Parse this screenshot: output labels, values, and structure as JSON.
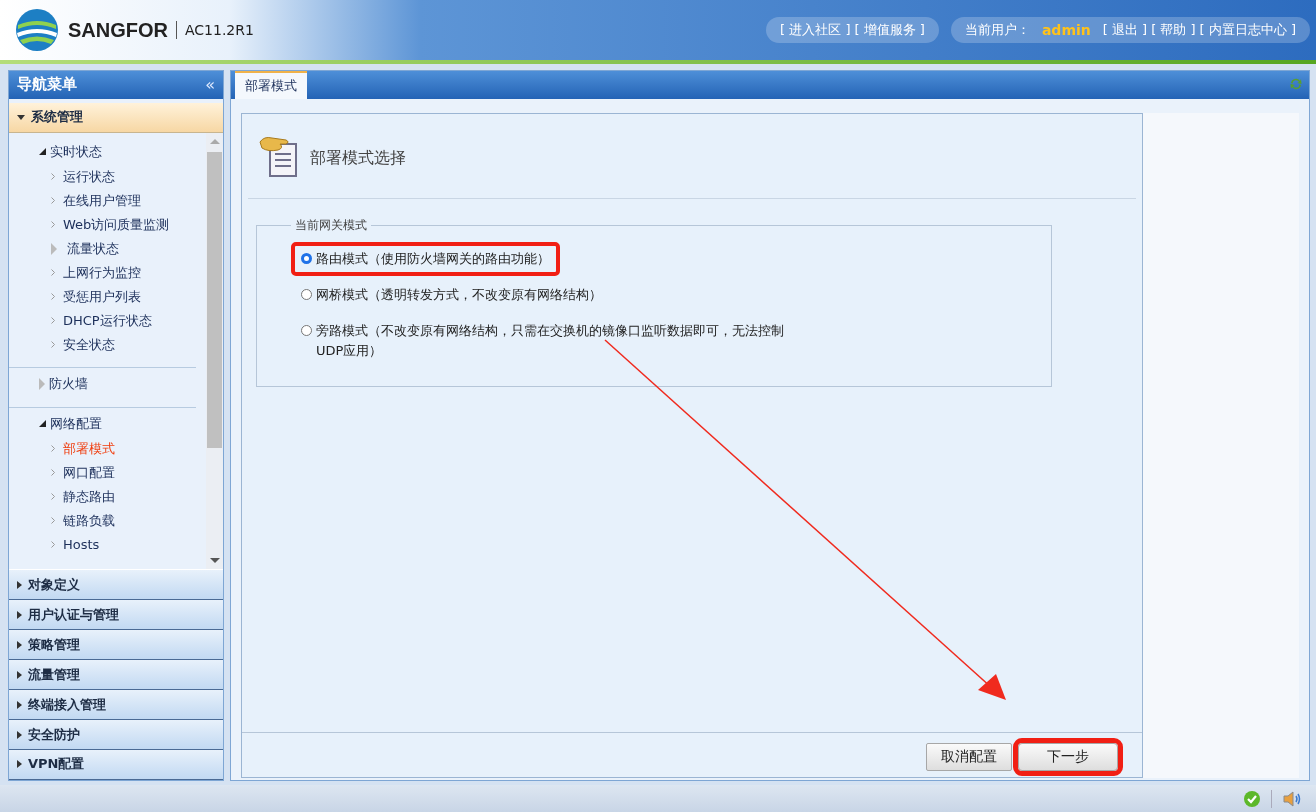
{
  "header": {
    "brand": "SANGFOR",
    "version": "AC11.2R1",
    "links": [
      "[ 进入社区 ]",
      "[ 增值服务 ]"
    ],
    "user_label": "当前用户：",
    "user_name": "admin",
    "user_links": [
      "[ 退出 ]",
      "[ 帮助 ]",
      "[ 内置日志中心 ]"
    ]
  },
  "sidebar": {
    "title": "导航菜单",
    "collapse_icon": "«",
    "sections": [
      {
        "label": "系统管理",
        "expanded": true,
        "tree": [
          {
            "label": "实时状态",
            "kind": "group",
            "expanded": true,
            "children": [
              {
                "label": "运行状态",
                "kind": "leaf",
                "selected": false
              },
              {
                "label": "在线用户管理",
                "kind": "leaf",
                "selected": false
              },
              {
                "label": "Web访问质量监测",
                "kind": "leaf",
                "selected": false
              },
              {
                "label": "流量状态",
                "kind": "group",
                "expanded": false
              },
              {
                "label": "上网行为监控",
                "kind": "leaf",
                "selected": false
              },
              {
                "label": "受惩用户列表",
                "kind": "leaf",
                "selected": false
              },
              {
                "label": "DHCP运行状态",
                "kind": "leaf",
                "selected": false
              },
              {
                "label": "安全状态",
                "kind": "leaf",
                "selected": false
              }
            ]
          },
          {
            "label": "防火墙",
            "kind": "group",
            "expanded": false
          },
          {
            "label": "网络配置",
            "kind": "group",
            "expanded": true,
            "children": [
              {
                "label": "部署模式",
                "kind": "leaf",
                "selected": true
              },
              {
                "label": "网口配置",
                "kind": "leaf",
                "selected": false
              },
              {
                "label": "静态路由",
                "kind": "leaf",
                "selected": false
              },
              {
                "label": "链路负载",
                "kind": "leaf",
                "selected": false
              },
              {
                "label": "Hosts",
                "kind": "leaf",
                "selected": false
              }
            ]
          }
        ]
      },
      {
        "label": "对象定义",
        "expanded": false
      },
      {
        "label": "用户认证与管理",
        "expanded": false
      },
      {
        "label": "策略管理",
        "expanded": false
      },
      {
        "label": "流量管理",
        "expanded": false
      },
      {
        "label": "终端接入管理",
        "expanded": false
      },
      {
        "label": "安全防护",
        "expanded": false
      },
      {
        "label": "VPN配置",
        "expanded": false
      }
    ]
  },
  "tabs": [
    {
      "label": "部署模式",
      "selected": true
    }
  ],
  "panel": {
    "heading": "部署模式选择",
    "legend": "当前网关模式",
    "options": [
      {
        "label": "路由模式（使用防火墙网关的路由功能）",
        "selected": true,
        "highlighted": true
      },
      {
        "label": "网桥模式（透明转发方式，不改变原有网络结构）",
        "selected": false,
        "highlighted": false
      },
      {
        "label": "旁路模式（不改变原有网络结构，只需在交换机的镜像口监听数据即可，无法控制UDP应用）",
        "selected": false,
        "highlighted": false
      }
    ],
    "buttons": [
      {
        "label": "取消配置",
        "highlighted": false
      },
      {
        "label": "下一步",
        "highlighted": true
      }
    ]
  }
}
